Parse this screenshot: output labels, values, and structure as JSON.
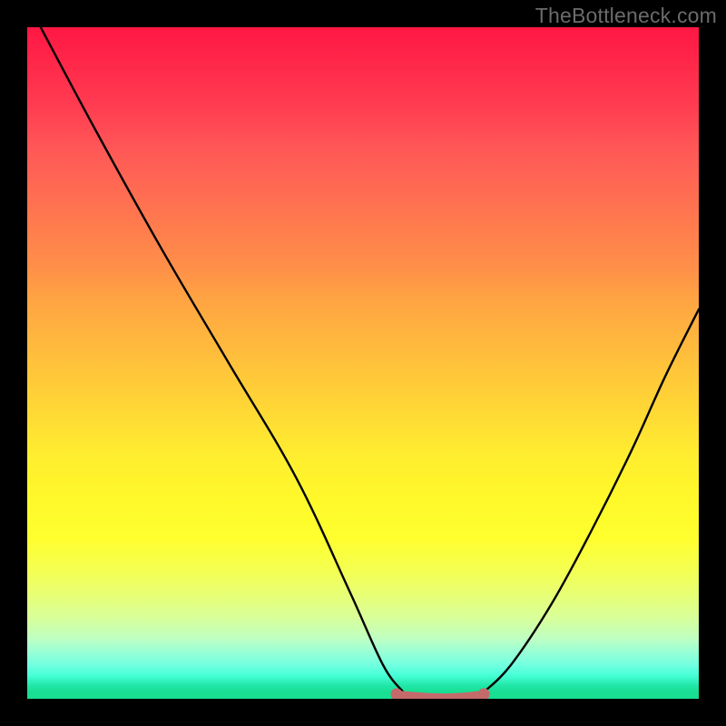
{
  "watermark": "TheBottleneck.com",
  "chart_data": {
    "type": "line",
    "title": "",
    "xlabel": "",
    "ylabel": "",
    "xlim": [
      0,
      100
    ],
    "ylim": [
      0,
      100
    ],
    "background": "rainbow_gradient_red_to_green",
    "series": [
      {
        "name": "left-curve",
        "x": [
          2,
          10,
          20,
          30,
          40,
          48,
          53,
          56
        ],
        "values": [
          100,
          85,
          67,
          50,
          33,
          16,
          5,
          1
        ],
        "stroke": "#000000",
        "stroke_width": 2.4
      },
      {
        "name": "right-curve",
        "x": [
          68,
          72,
          78,
          84,
          90,
          95,
          100
        ],
        "values": [
          1,
          5,
          14,
          25,
          37,
          48,
          58
        ],
        "stroke": "#000000",
        "stroke_width": 2.4
      },
      {
        "name": "bottom-flat-marker",
        "x": [
          55,
          60,
          64,
          68
        ],
        "values": [
          0.5,
          0.1,
          0.1,
          0.5
        ],
        "stroke": "#c56a6a",
        "stroke_width": 11
      }
    ],
    "markers": [
      {
        "name": "flat-left-endcap",
        "x": 55,
        "y": 0.7,
        "r": 6.5,
        "fill": "#c56a6a"
      },
      {
        "name": "flat-right-endcap",
        "x": 68,
        "y": 0.7,
        "r": 6.5,
        "fill": "#c56a6a"
      }
    ]
  },
  "colors": {
    "frame": "#000000",
    "watermark_text": "#6b6b6b"
  }
}
